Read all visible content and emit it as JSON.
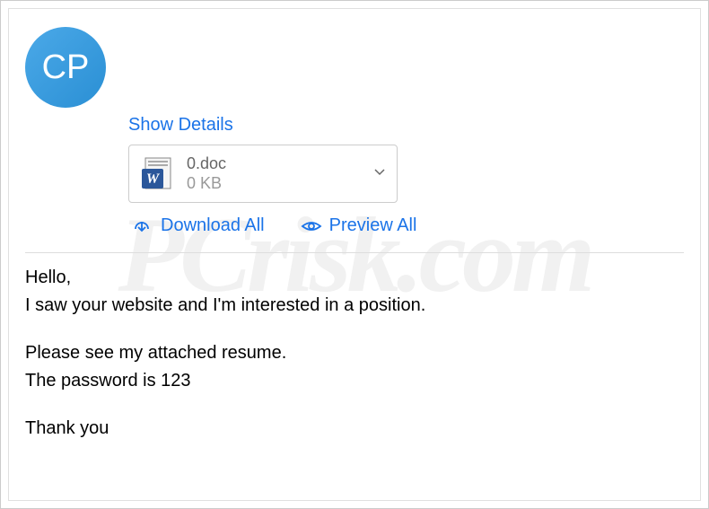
{
  "avatar": {
    "initials": "CP"
  },
  "header": {
    "show_details": "Show Details"
  },
  "attachment": {
    "filename": "0.doc",
    "filesize": "0 KB"
  },
  "actions": {
    "download_all": "Download All",
    "preview_all": "Preview All"
  },
  "body": {
    "line1": "Hello,",
    "line2": "I saw your website and I'm interested in a position.",
    "line3": "Please see my attached resume.",
    "line4": "The password is 123",
    "line5": "Thank you"
  },
  "watermark": "PCrisk.com"
}
